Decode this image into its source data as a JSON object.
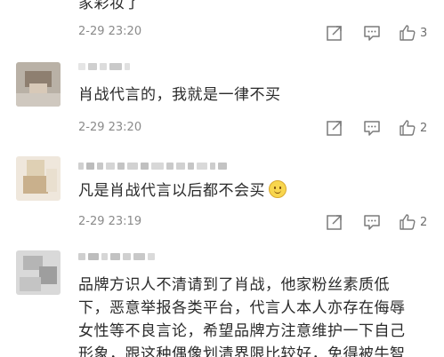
{
  "comments": [
    {
      "text": "家彩妆了",
      "time": "2-29 23:20",
      "likes": "3",
      "actions": [
        "share-icon",
        "comment-icon",
        "like-icon"
      ]
    },
    {
      "text": "肖战代言的，我就是一律不买",
      "time": "2-29 23:20",
      "likes": "2",
      "actions": [
        "share-icon",
        "comment-icon",
        "like-icon"
      ]
    },
    {
      "text": "凡是肖战代言以后都不会买",
      "time": "2-29 23:19",
      "likes": "2",
      "emoji": "smile-emoji",
      "actions": [
        "share-icon",
        "comment-icon",
        "like-icon"
      ]
    },
    {
      "text_lines": [
        "品牌方识人不清请到了肖战，他家粉丝素质低",
        "下，恶意举报各类平台，代言人本人亦存在侮辱",
        "女性等不良言论，希望品牌方注意维护一下自己",
        "形象，跟这种偶像划清界限比较好，免得被牛智"
      ]
    }
  ],
  "colors": {
    "text": "#2a2a2a",
    "time": "#8a8a8a",
    "icon": "#7a7a7a",
    "background": "#ffffff"
  }
}
